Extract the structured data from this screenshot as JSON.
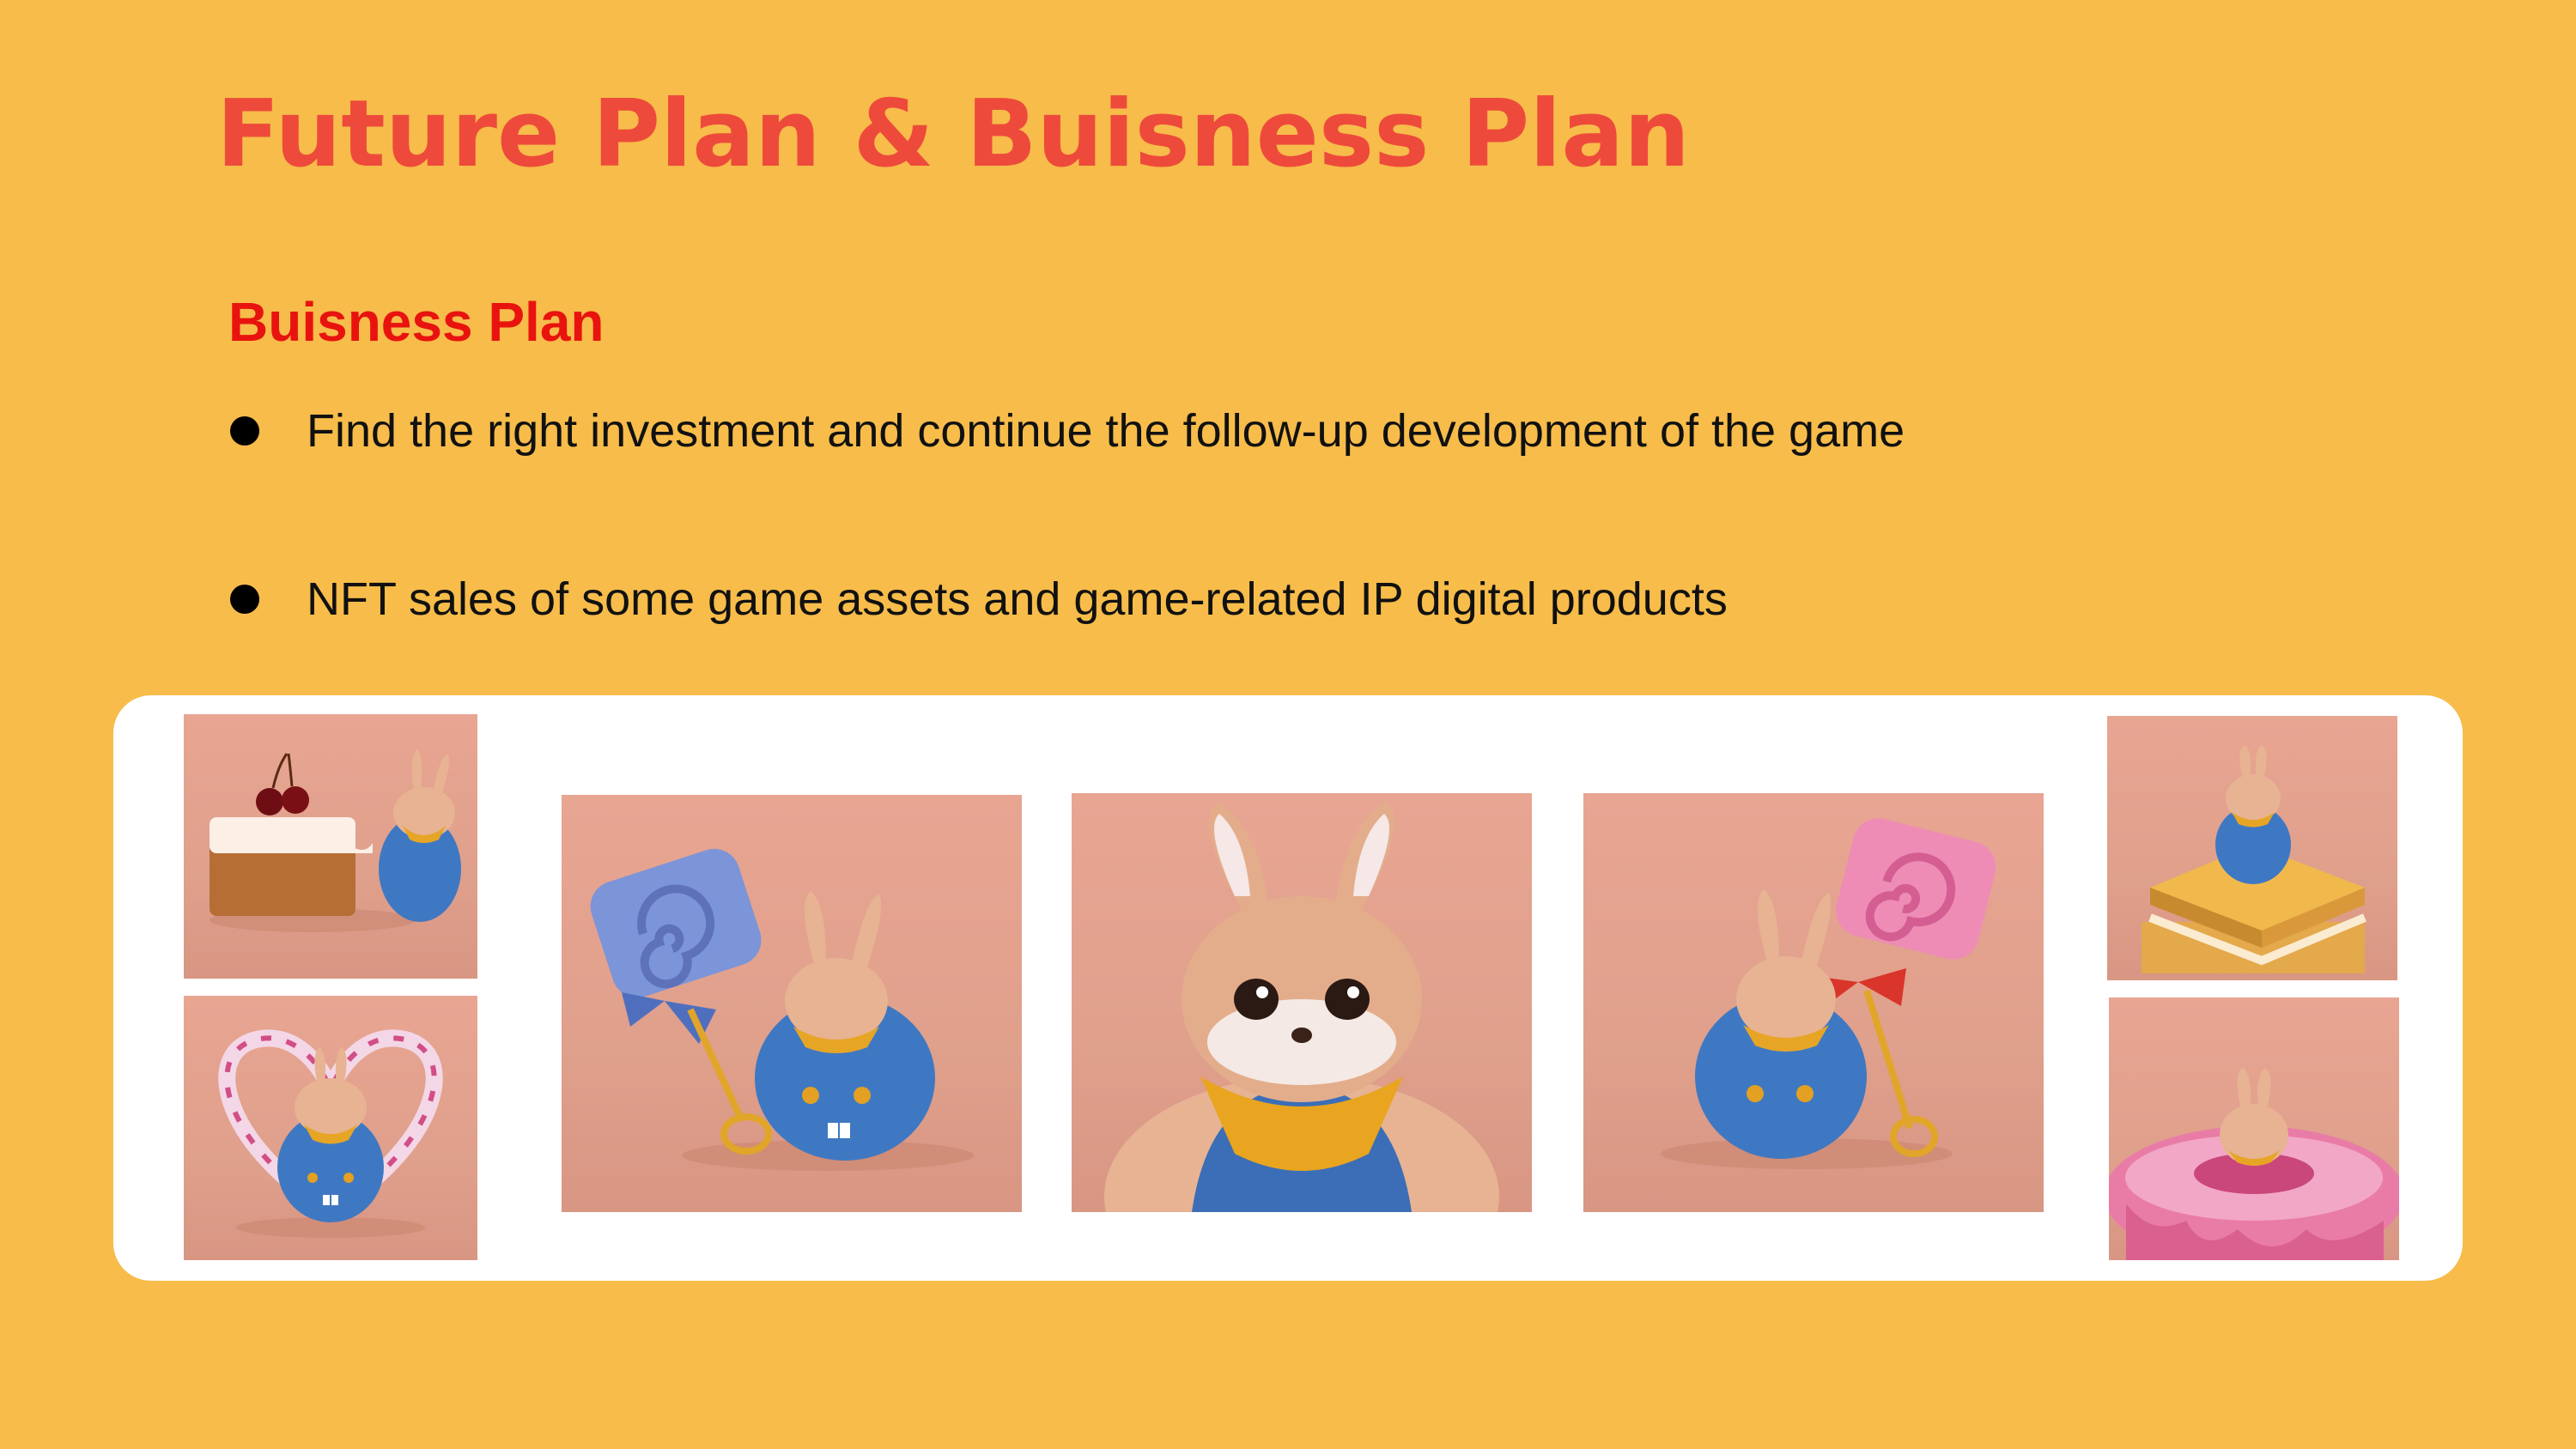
{
  "slide": {
    "title": "Future Plan & Buisness Plan",
    "section_heading": "Buisness Plan",
    "bullets": [
      "Find the right investment and continue the follow-up development of the game",
      "NFT sales of some game assets and game-related IP digital products"
    ]
  },
  "gallery": {
    "images": [
      {
        "subject": "rabbit-with-cherry-cake"
      },
      {
        "subject": "rabbit-with-heart-candy"
      },
      {
        "subject": "rabbit-with-blue-lollipop"
      },
      {
        "subject": "rabbit-face-closeup"
      },
      {
        "subject": "rabbit-with-pink-lollipop"
      },
      {
        "subject": "rabbit-on-biscuit-stack"
      },
      {
        "subject": "rabbit-in-pink-donut"
      }
    ]
  },
  "colors": {
    "background": "#F7BC4A",
    "title": "#EE4A3B",
    "heading": "#E8130F",
    "panel": "#FFFFFF",
    "photo_bg": "#E3A28E"
  }
}
